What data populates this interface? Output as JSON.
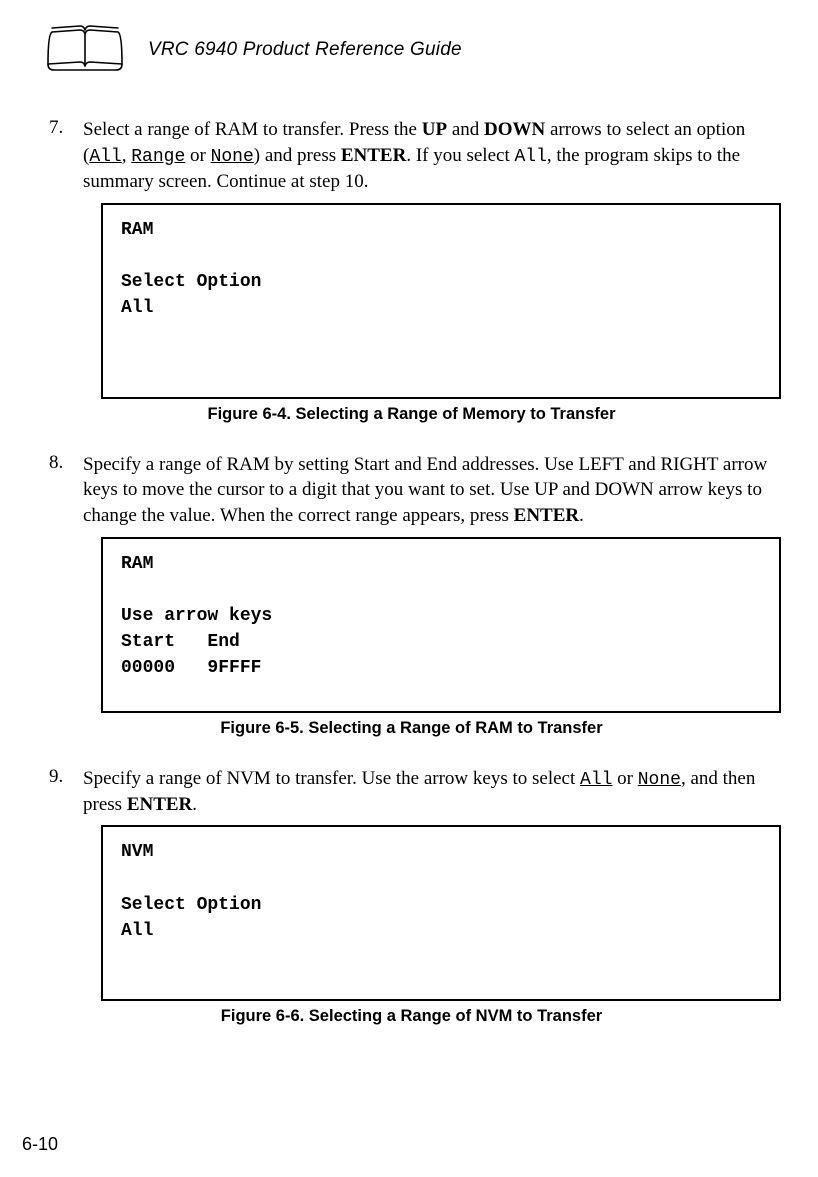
{
  "header": {
    "title": "VRC 6940 Product Reference Guide"
  },
  "steps": {
    "s7": {
      "num": "7.",
      "t1": "Select a range of RAM to transfer. Press the ",
      "b1": "UP",
      "t2": " and ",
      "b2": "DOWN",
      "t3": " arrows to select an option (",
      "m1": "All",
      "t4": ", ",
      "m2": "Range",
      "t5": " or ",
      "m3": "None",
      "t6": ") and press ",
      "b3": "ENTER",
      "t7": ". If you select ",
      "m4": "All",
      "t8": ", the program skips to the summary screen. Continue at step 10."
    },
    "s8": {
      "num": "8.",
      "t1": "Specify a range of RAM by setting Start and End addresses. Use LEFT and RIGHT arrow keys to move the cursor to a digit that you want to set. Use UP and DOWN arrow keys to change the value. When the correct range appears, press ",
      "b1": "ENTER",
      "t2": "."
    },
    "s9": {
      "num": "9.",
      "t1": "Specify a range of NVM to transfer. Use the arrow keys to select ",
      "m1": "All",
      "t2": " or ",
      "m2": "None",
      "t3": ", and then press ",
      "b1": "ENTER",
      "t4": "."
    }
  },
  "screens": {
    "box1": "RAM\n\nSelect Option\nAll",
    "box2": "RAM\n\nUse arrow keys\nStart   End\n00000   9FFFF",
    "box3": "NVM\n\nSelect Option\nAll"
  },
  "figures": {
    "f1": "Figure 6-4.  Selecting a Range of Memory to Transfer",
    "f2": "Figure 6-5.  Selecting a Range of RAM to Transfer",
    "f3": "Figure 6-6.  Selecting a Range of NVM to Transfer"
  },
  "page_number": "6-10"
}
